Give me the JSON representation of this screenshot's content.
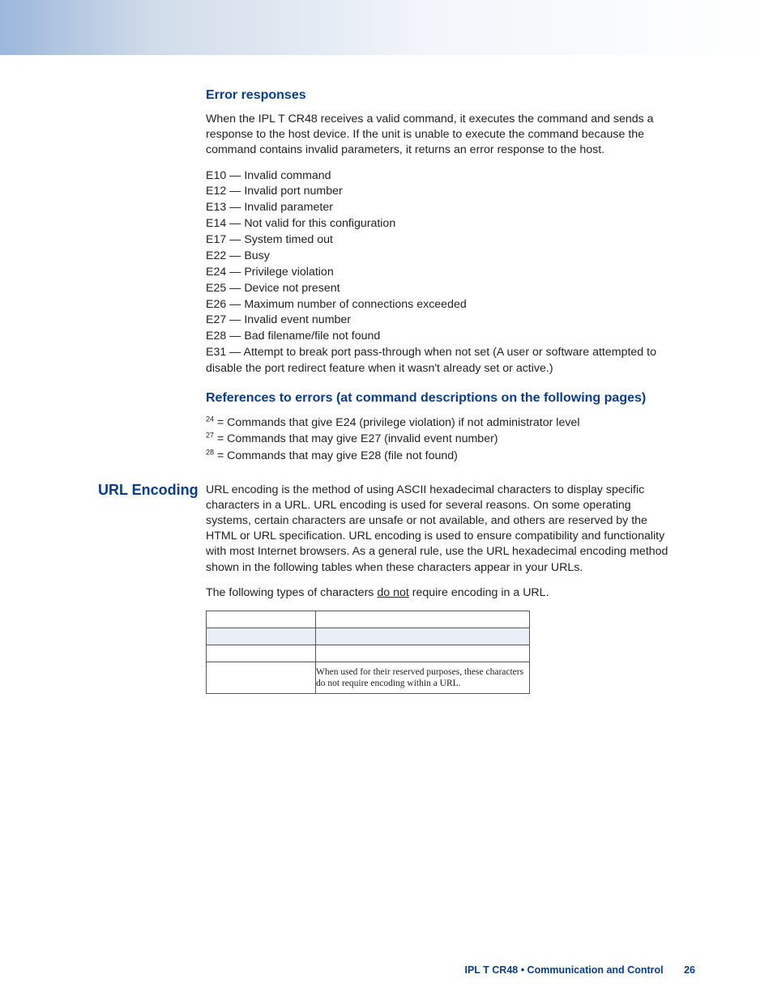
{
  "headings": {
    "error_responses": "Error responses",
    "references": "References to errors (at command descriptions on the following pages)",
    "url_encoding": "URL Encoding"
  },
  "paragraphs": {
    "error_intro": "When the IPL T CR48 receives a valid command, it executes the command and sends a response to the host device. If the unit is unable to execute the command because the command contains invalid parameters, it returns an error response to the host.",
    "url_intro": "URL encoding is the method of using ASCII hexadecimal characters to display specific characters in a URL. URL encoding is used for several reasons. On some operating systems, certain characters are unsafe or not available, and others are reserved by the HTML or URL specification. URL encoding is used to ensure compatibility and functionality with most Internet browsers. As a general rule, use the URL hexadecimal encoding method shown in the following tables when these characters appear in your URLs.",
    "url_note_pre": "The following types of characters ",
    "url_note_underline": "do not",
    "url_note_post": " require encoding in a URL."
  },
  "errors": [
    "E10 — Invalid command",
    "E12 — Invalid port number",
    "E13 — Invalid parameter",
    "E14 — Not valid for this configuration",
    "E17 — System timed out",
    "E22 — Busy",
    "E24 — Privilege violation",
    "E25 — Device not present",
    "E26 — Maximum number of connections exceeded",
    "E27 — Invalid event number",
    "E28 — Bad filename/file not found",
    "E31 — Attempt to break port pass-through when not set (A user or software attempted to disable the port redirect feature when it wasn't already set or active.)"
  ],
  "references": [
    {
      "sup": "24",
      "text": " = Commands that give E24 (privilege violation) if not administrator level"
    },
    {
      "sup": "27",
      "text": " = Commands that may give E27 (invalid event number)"
    },
    {
      "sup": "28",
      "text": " = Commands that may give E28 (file not found)"
    }
  ],
  "table": {
    "note": "When used for their reserved purposes, these characters do not require encoding within a URL."
  },
  "footer": {
    "text": "IPL T CR48 • Communication and Control",
    "page": "26"
  }
}
